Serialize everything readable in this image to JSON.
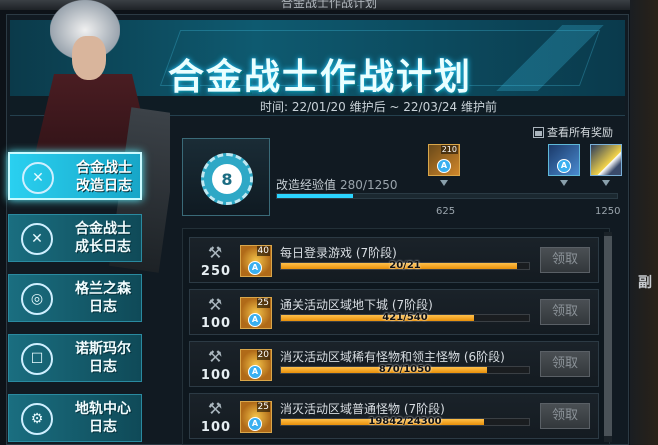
{
  "window": {
    "title": "合金战士作战计划"
  },
  "banner": {
    "title": "合金战士作战计划",
    "date_range": "时间: 22/01/20 维护后 ~ 22/03/24 维护前"
  },
  "all_rewards_label": "查看所有奖励",
  "sidebar": [
    {
      "label_line1": "合金战士",
      "label_line2": "改造日志",
      "active": true
    },
    {
      "label_line1": "合金战士",
      "label_line2": "成长日志",
      "active": false
    },
    {
      "label_line1": "格兰之森",
      "label_line2": "日志",
      "active": false
    },
    {
      "label_line1": "诺斯玛尔",
      "label_line2": "日志",
      "active": false
    },
    {
      "label_line1": "地轨中心",
      "label_line2": "日志",
      "active": false
    }
  ],
  "level": {
    "value": "8"
  },
  "exp": {
    "label": "改造经验值",
    "value_text": "280/1250",
    "current": 280,
    "max": 1250,
    "markers": [
      "625",
      "1250"
    ]
  },
  "milestone_rewards": [
    {
      "count": "210",
      "letter": "A"
    },
    {
      "count": "",
      "letter": "A"
    },
    {
      "count": "",
      "letter": ""
    }
  ],
  "tasks": [
    {
      "points": "250",
      "reward_count": "40",
      "reward_letter": "A",
      "name": "每日登录游戏 (7阶段)",
      "progress_text": "20/21",
      "progress": 0.952,
      "claim": "领取"
    },
    {
      "points": "100",
      "reward_count": "25",
      "reward_letter": "A",
      "name": "通关活动区域地下城 (7阶段)",
      "progress_text": "421/540",
      "progress": 0.78,
      "claim": "领取"
    },
    {
      "points": "100",
      "reward_count": "20",
      "reward_letter": "A",
      "name": "消灭活动区域稀有怪物和领主怪物 (6阶段)",
      "progress_text": "870/1050",
      "progress": 0.829,
      "claim": "领取"
    },
    {
      "points": "100",
      "reward_count": "25",
      "reward_letter": "A",
      "name": "消灭活动区域普通怪物 (7阶段)",
      "progress_text": "19842/24300",
      "progress": 0.817,
      "claim": "领取"
    }
  ],
  "side_char": "副"
}
